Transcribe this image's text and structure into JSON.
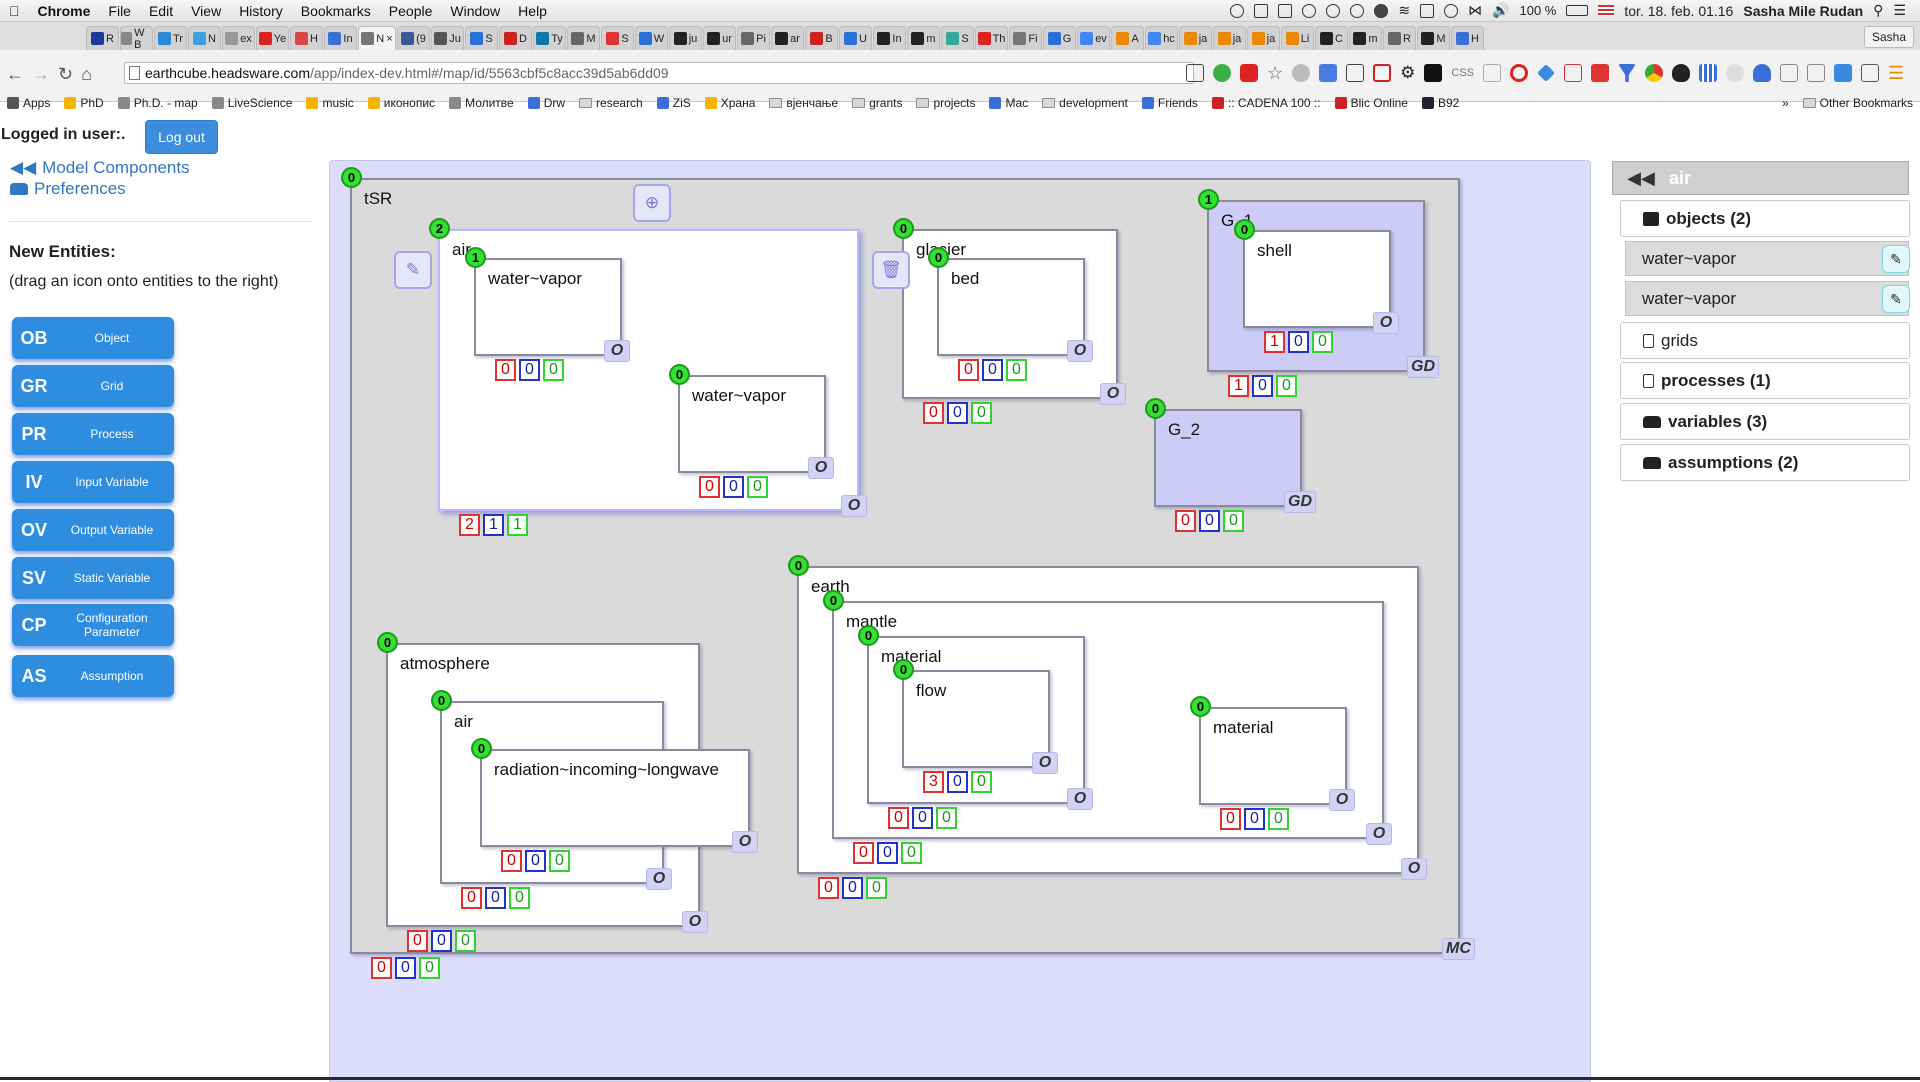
{
  "menubar": {
    "app": "Chrome",
    "items": [
      "File",
      "Edit",
      "View",
      "History",
      "Bookmarks",
      "People",
      "Window",
      "Help"
    ],
    "battery": "100 %",
    "datetime": "tor. 18. feb.  01.16",
    "user": "Sasha Mile Rudan"
  },
  "browser": {
    "tabs": [
      {
        "label": "R",
        "color": "#1a3a9a"
      },
      {
        "label": "W B",
        "color": "#888"
      },
      {
        "label": "Tr",
        "color": "#2a8ad8"
      },
      {
        "label": "N",
        "color": "#3aa0e0"
      },
      {
        "label": "ex",
        "color": "#999"
      },
      {
        "label": "Ye",
        "color": "#d22"
      },
      {
        "label": "H",
        "color": "#d44"
      },
      {
        "label": "In",
        "color": "#3a6fd8"
      },
      {
        "label": "N",
        "color": "#777",
        "active": true
      },
      {
        "label": "(9",
        "color": "#3b5998"
      },
      {
        "label": "Ju",
        "color": "#555"
      },
      {
        "label": "S",
        "color": "#2a6fd8"
      },
      {
        "label": "D",
        "color": "#c22"
      },
      {
        "label": "Ty",
        "color": "#0e76a8"
      },
      {
        "label": "M",
        "color": "#666"
      },
      {
        "label": "S",
        "color": "#d33"
      },
      {
        "label": "W",
        "color": "#2a6fd8"
      },
      {
        "label": "ju",
        "color": "#222"
      },
      {
        "label": "ur",
        "color": "#222"
      },
      {
        "label": "Pi",
        "color": "#666"
      },
      {
        "label": "ar",
        "color": "#222"
      },
      {
        "label": "B",
        "color": "#c22"
      },
      {
        "label": "U",
        "color": "#2a6fd8"
      },
      {
        "label": "In",
        "color": "#222"
      },
      {
        "label": "m",
        "color": "#222"
      },
      {
        "label": "S",
        "color": "#3a9"
      },
      {
        "label": "Th",
        "color": "#d22"
      },
      {
        "label": "Fi",
        "color": "#777"
      },
      {
        "label": "G",
        "color": "#2a6fd8"
      },
      {
        "label": "ev",
        "color": "#4285f4"
      },
      {
        "label": "A",
        "color": "#e80"
      },
      {
        "label": "hc",
        "color": "#4285f4"
      },
      {
        "label": "ja",
        "color": "#e80"
      },
      {
        "label": "ja",
        "color": "#e80"
      },
      {
        "label": "ja",
        "color": "#e80"
      },
      {
        "label": "Li",
        "color": "#e80"
      },
      {
        "label": "C",
        "color": "#222"
      },
      {
        "label": "m",
        "color": "#222"
      },
      {
        "label": "R",
        "color": "#666"
      },
      {
        "label": "M",
        "color": "#222"
      },
      {
        "label": "H",
        "color": "#3a6fd8"
      }
    ],
    "profile": "Sasha",
    "url_host": "earthcube.headsware.com",
    "url_path": "/app/index-dev.html#/map/id/5563cbf5c8acc39d5ab6dd09",
    "bookmarks": [
      {
        "label": "Apps",
        "icon": "apps-grid-icon"
      },
      {
        "label": "PhD",
        "icon": "drive-icon"
      },
      {
        "label": "Ph.D. - map",
        "icon": "gear-icon"
      },
      {
        "label": "LiveScience",
        "icon": "livescience-icon"
      },
      {
        "label": "music",
        "icon": "drive-icon"
      },
      {
        "label": "иконопис",
        "icon": "drive-icon"
      },
      {
        "label": "Молитве",
        "icon": "molitve-icon"
      },
      {
        "label": "Drw",
        "icon": "doc-icon"
      },
      {
        "label": "research",
        "icon": "folder-icon"
      },
      {
        "label": "ZiS",
        "icon": "doc-icon"
      },
      {
        "label": "Храна",
        "icon": "drive-icon"
      },
      {
        "label": "вјенчање",
        "icon": "folder-icon"
      },
      {
        "label": "grants",
        "icon": "folder-icon"
      },
      {
        "label": "projects",
        "icon": "folder-icon"
      },
      {
        "label": "Mac",
        "icon": "doc-icon"
      },
      {
        "label": "development",
        "icon": "folder-icon"
      },
      {
        "label": "Friends",
        "icon": "doc-icon"
      },
      {
        "label": ":: CADENA 100 ::",
        "icon": "cadena-icon"
      },
      {
        "label": "Blic Online",
        "icon": "blic-icon"
      },
      {
        "label": "B92",
        "icon": "b92-icon"
      }
    ],
    "bookmarks_more": "»",
    "other_bookmarks": "Other Bookmarks"
  },
  "sidebar": {
    "logged_in_label": "Logged in user:.",
    "logout_label": "Log out",
    "model_components_label": "Model Components",
    "preferences_label": "Preferences",
    "new_entities_title": "New Entities:",
    "drag_hint": "(drag an icon onto entities to the right)",
    "palette": [
      {
        "abbr": "OB",
        "label": "Object"
      },
      {
        "abbr": "GR",
        "label": "Grid"
      },
      {
        "abbr": "PR",
        "label": "Process"
      },
      {
        "abbr": "IV",
        "label": "Input Variable"
      },
      {
        "abbr": "OV",
        "label": "Output Variable"
      },
      {
        "abbr": "SV",
        "label": "Static Variable"
      },
      {
        "abbr": "CP",
        "label": "Configuration Parameter"
      },
      {
        "abbr": "AS",
        "label": "Assumption"
      }
    ]
  },
  "canvas": {
    "entities": [
      {
        "id": "tSR",
        "label": "tSR",
        "count": "0",
        "type": "MC",
        "kind": "mc",
        "counters": [
          "0",
          "0",
          "0"
        ]
      },
      {
        "id": "air",
        "label": "air",
        "count": "2",
        "type": "O",
        "kind": "obj",
        "selected": true,
        "counters": [
          "2",
          "1",
          "1"
        ]
      },
      {
        "id": "air-wv1",
        "label": "water~vapor",
        "count": "1",
        "type": "O",
        "kind": "obj",
        "counters": [
          "0",
          "0",
          "0"
        ]
      },
      {
        "id": "air-wv2",
        "label": "water~vapor",
        "count": "0",
        "type": "O",
        "kind": "obj",
        "counters": [
          "0",
          "0",
          "0"
        ]
      },
      {
        "id": "glacier",
        "label": "glacier",
        "count": "0",
        "type": "O",
        "kind": "obj",
        "counters": [
          "0",
          "0",
          "0"
        ]
      },
      {
        "id": "bed",
        "label": "bed",
        "count": "0",
        "type": "O",
        "kind": "obj",
        "counters": [
          "0",
          "0",
          "0"
        ]
      },
      {
        "id": "G_1",
        "label": "G_1",
        "count": "1",
        "type": "GD",
        "kind": "grid",
        "counters": [
          "1",
          "0",
          "0"
        ]
      },
      {
        "id": "shell",
        "label": "shell",
        "count": "0",
        "type": "O",
        "kind": "obj",
        "counters": [
          "1",
          "0",
          "0"
        ]
      },
      {
        "id": "G_2",
        "label": "G_2",
        "count": "0",
        "type": "GD",
        "kind": "grid",
        "counters": [
          "0",
          "0",
          "0"
        ]
      },
      {
        "id": "earth",
        "label": "earth",
        "count": "0",
        "type": "O",
        "kind": "obj",
        "counters": [
          "0",
          "0",
          "0"
        ]
      },
      {
        "id": "mantle",
        "label": "mantle",
        "count": "0",
        "type": "O",
        "kind": "obj",
        "counters": [
          "0",
          "0",
          "0"
        ]
      },
      {
        "id": "material1",
        "label": "material",
        "count": "0",
        "type": "O",
        "kind": "obj",
        "counters": [
          "0",
          "0",
          "0"
        ]
      },
      {
        "id": "flow",
        "label": "flow",
        "count": "0",
        "type": "O",
        "kind": "obj",
        "counters": [
          "3",
          "0",
          "0"
        ]
      },
      {
        "id": "material2",
        "label": "material",
        "count": "0",
        "type": "O",
        "kind": "obj",
        "counters": [
          "0",
          "0",
          "0"
        ]
      },
      {
        "id": "atmosphere",
        "label": "atmosphere",
        "count": "0",
        "type": "O",
        "kind": "obj",
        "counters": [
          "0",
          "0",
          "0"
        ]
      },
      {
        "id": "atm-air",
        "label": "air",
        "count": "0",
        "type": "O",
        "kind": "obj",
        "counters": [
          "0",
          "0",
          "0"
        ]
      },
      {
        "id": "radiation",
        "label": "radiation~incoming~longwave",
        "count": "0",
        "type": "O",
        "kind": "obj",
        "counters": [
          "0",
          "0",
          "0"
        ]
      }
    ],
    "tools": [
      "add-circle-icon",
      "pencil-icon",
      "trash-icon"
    ]
  },
  "rightpanel": {
    "title": "air",
    "objects_label": "objects (2)",
    "objects": [
      "water~vapor",
      "water~vapor"
    ],
    "grids_label": "grids",
    "processes_label": "processes (1)",
    "variables_label": "variables (3)",
    "assumptions_label": "assumptions (2)"
  },
  "colors": {
    "canvas_bg": "#dcdcfb",
    "badge_green": "#33e033",
    "counter_red": "#e23030",
    "counter_blue": "#2233cc",
    "counter_green": "#2fd42f",
    "palette_blue": "#2f8de0",
    "link_blue": "#2f78c4"
  }
}
